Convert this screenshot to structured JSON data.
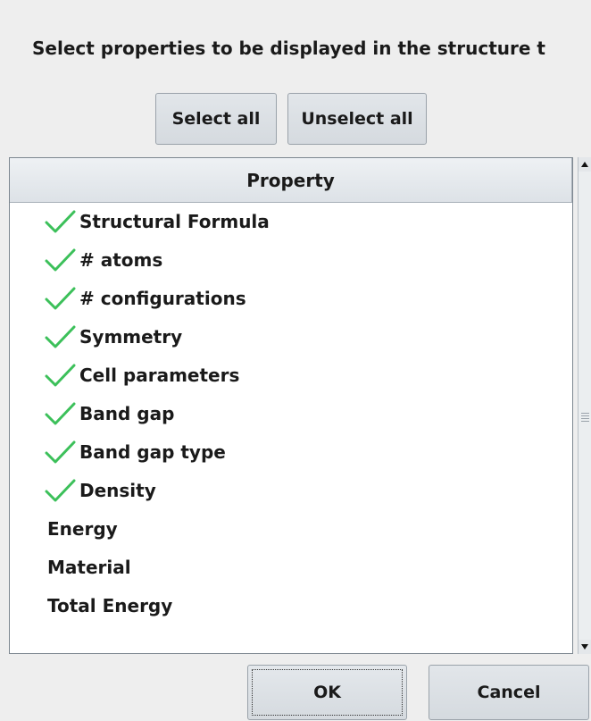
{
  "dialog": {
    "instruction": "Select properties to be displayed in the structure t",
    "select_all_label": "Select all",
    "unselect_all_label": "Unselect all",
    "ok_label": "OK",
    "cancel_label": "Cancel"
  },
  "table": {
    "header": "Property",
    "rows": [
      {
        "label": "Structural Formula",
        "checked": true
      },
      {
        "label": "# atoms",
        "checked": true
      },
      {
        "label": "# configurations",
        "checked": true
      },
      {
        "label": "Symmetry",
        "checked": true
      },
      {
        "label": "Cell parameters",
        "checked": true
      },
      {
        "label": "Band gap",
        "checked": true
      },
      {
        "label": "Band gap type",
        "checked": true
      },
      {
        "label": "Density",
        "checked": true
      },
      {
        "label": "Energy",
        "checked": false
      },
      {
        "label": "Material",
        "checked": false
      },
      {
        "label": "Total Energy",
        "checked": false
      }
    ]
  },
  "colors": {
    "check": "#3cc05a",
    "background": "#eeeeee"
  },
  "icons": {
    "check": "check-icon",
    "scroll_up": "arrow-up-icon",
    "scroll_down": "arrow-down-icon"
  }
}
